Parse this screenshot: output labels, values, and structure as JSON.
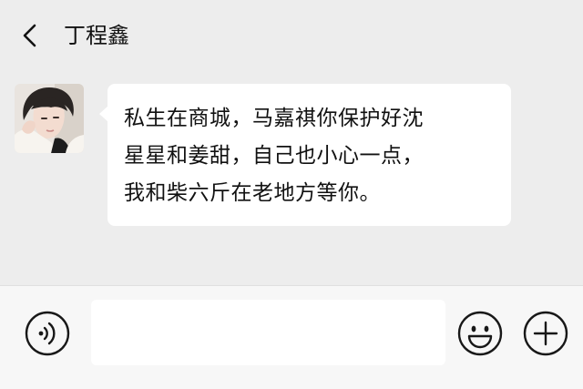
{
  "header": {
    "back_icon": "chevron-left-icon",
    "contact_name": "丁程鑫"
  },
  "message": {
    "sender_avatar": "avatar-photo",
    "lines": [
      "私生在商城，马嘉祺你保护好沈",
      "星星和姜甜，自己也小心一点，",
      "我和柴六斤在老地方等你。"
    ],
    "bubble_color": "#ffffff"
  },
  "input_bar": {
    "voice_icon": "voice-icon",
    "text_value": "",
    "emoji_icon": "smiley-icon",
    "plus_icon": "plus-circle-icon"
  },
  "colors": {
    "background": "#ededed",
    "input_bar": "#f7f7f7",
    "text": "#111111"
  }
}
